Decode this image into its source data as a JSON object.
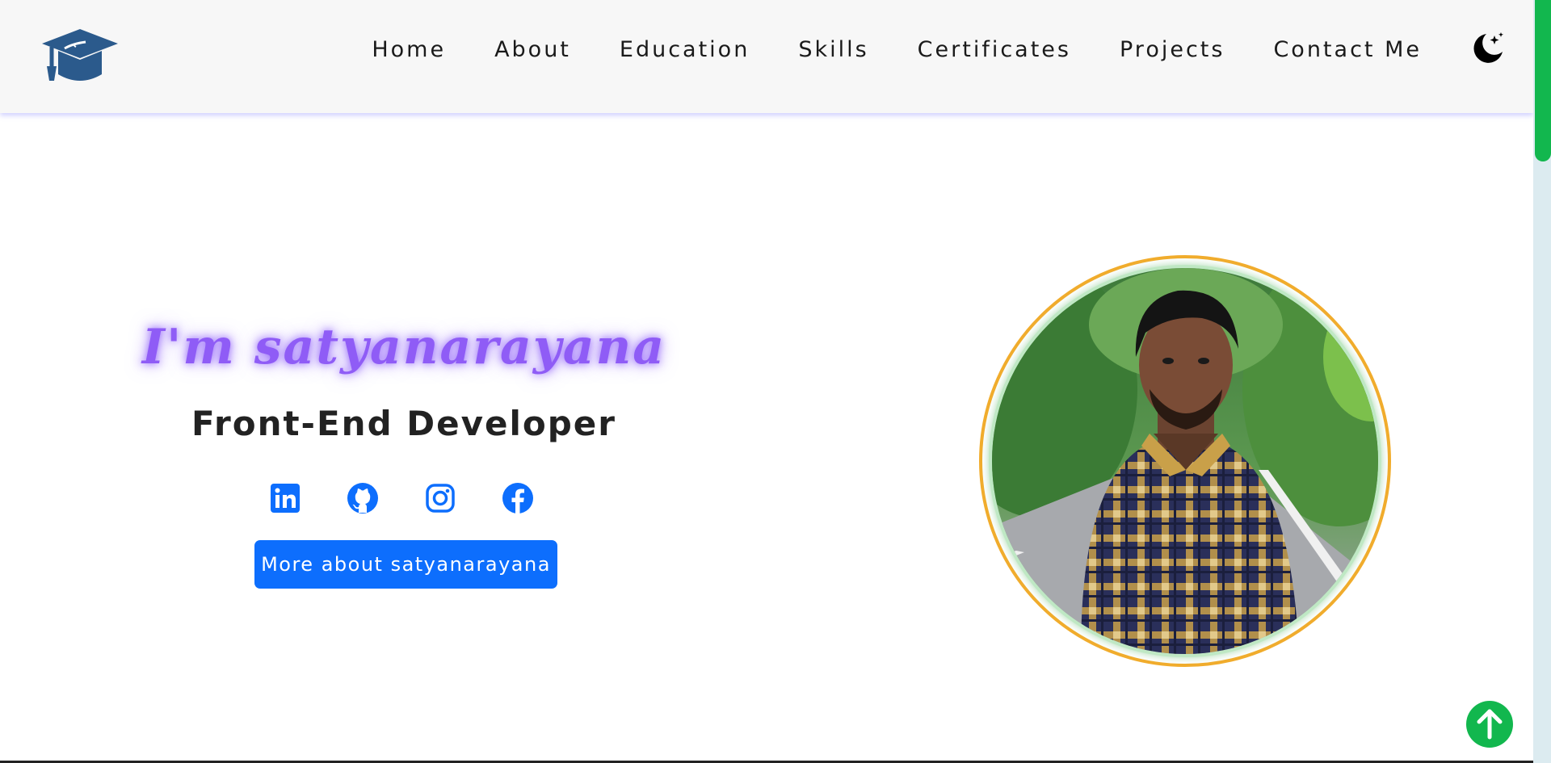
{
  "navbar": {
    "logo_icon": "graduation-cap-icon",
    "links": [
      {
        "label": "Home"
      },
      {
        "label": "About"
      },
      {
        "label": "Education"
      },
      {
        "label": "Skills"
      },
      {
        "label": "Certificates"
      },
      {
        "label": "Projects"
      },
      {
        "label": "Contact Me"
      }
    ],
    "theme_toggle_icon": "moon-stars-icon"
  },
  "hero": {
    "greeting": "I'm satyanarayana",
    "role": "Front-End Developer",
    "socials": [
      {
        "icon": "linkedin-icon"
      },
      {
        "icon": "github-icon"
      },
      {
        "icon": "instagram-icon"
      },
      {
        "icon": "facebook-icon"
      }
    ],
    "cta_label": "More about satyanarayana",
    "profile_image": "profile-photo"
  },
  "scrollbar": {
    "position": 0.0
  },
  "back_to_top_icon": "arrow-up-icon",
  "colors": {
    "accent_blue": "#0d6efd",
    "title_purple": "#8f5cf6",
    "logo_blue": "#2b5a8c",
    "ring_orange": "#f2ac2c",
    "scroll_green": "#12b74e",
    "navbar_bg": "#f7f7f7"
  }
}
